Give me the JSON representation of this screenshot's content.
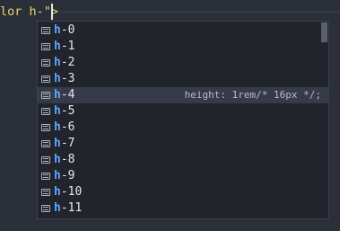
{
  "editor": {
    "line_text": "lor h-\">"
  },
  "suggest": {
    "query_prefix": "h",
    "items": [
      {
        "label": "h-0",
        "match": "h",
        "rest": "-0"
      },
      {
        "label": "h-1",
        "match": "h",
        "rest": "-1"
      },
      {
        "label": "h-2",
        "match": "h",
        "rest": "-2"
      },
      {
        "label": "h-3",
        "match": "h",
        "rest": "-3"
      },
      {
        "label": "h-4",
        "match": "h",
        "rest": "-4",
        "detail": "height: 1rem/* 16px */;"
      },
      {
        "label": "h-5",
        "match": "h",
        "rest": "-5"
      },
      {
        "label": "h-6",
        "match": "h",
        "rest": "-6"
      },
      {
        "label": "h-7",
        "match": "h",
        "rest": "-7"
      },
      {
        "label": "h-8",
        "match": "h",
        "rest": "-8"
      },
      {
        "label": "h-9",
        "match": "h",
        "rest": "-9"
      },
      {
        "label": "h-10",
        "match": "h",
        "rest": "-10"
      },
      {
        "label": "h-11",
        "match": "h",
        "rest": "-11"
      }
    ],
    "selected_index": 4,
    "item_icon": "snippet-text-icon"
  },
  "colors": {
    "editor_background": "#2b2f3a",
    "suggest_background": "#21252b",
    "selected_background": "#363b48",
    "match_highlight": "#58a6ff",
    "code_text": "#e8d36b"
  }
}
